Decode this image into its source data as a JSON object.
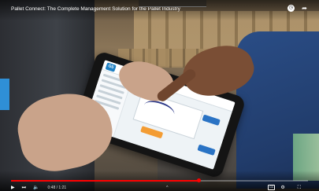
{
  "video": {
    "title": "Pallet Connect: The Complete Management Solution for the Pallet Industry",
    "progress_fraction": 0.63,
    "time_display": "0:48 / 1:21",
    "accent_color": "#ff0000",
    "chevron": "^"
  },
  "controls": {
    "play_icon": "▶",
    "next_icon": "⏭",
    "volume_icon": "🔈",
    "cc_label": "CC",
    "settings_icon": "⚙",
    "fullscreen_icon": "⛶"
  },
  "top_icons": {
    "watch_later": "◷",
    "share": "➦"
  },
  "tablet_app": {
    "logo_text": "GS"
  }
}
